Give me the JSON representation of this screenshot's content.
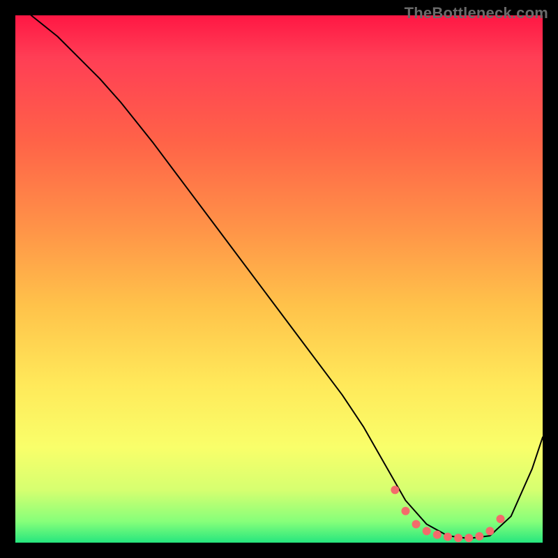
{
  "watermark": "TheBottleneck.com",
  "chart_data": {
    "type": "line",
    "title": "",
    "xlabel": "",
    "ylabel": "",
    "xlim": [
      0,
      100
    ],
    "ylim": [
      0,
      100
    ],
    "grid": false,
    "annotations": [],
    "series": [
      {
        "name": "curve",
        "color": "#000000",
        "stroke_width": 2,
        "x": [
          3,
          8,
          12,
          16,
          20,
          26,
          32,
          38,
          44,
          50,
          56,
          62,
          66,
          70,
          74,
          78,
          82,
          86,
          90,
          94,
          98,
          100
        ],
        "y": [
          100,
          96,
          92,
          88,
          83.5,
          76,
          68,
          60,
          52,
          44,
          36,
          28,
          22,
          15,
          8,
          3.5,
          1.3,
          0.8,
          1.3,
          5,
          14,
          20
        ]
      },
      {
        "name": "valley-dots",
        "color": "#f36b6b",
        "marker": "circle",
        "marker_size": 6,
        "x": [
          72,
          74,
          76,
          78,
          80,
          82,
          84,
          86,
          88,
          90,
          92
        ],
        "y": [
          10,
          6,
          3.5,
          2.2,
          1.5,
          1.1,
          0.9,
          0.9,
          1.2,
          2.2,
          4.5
        ]
      }
    ]
  }
}
